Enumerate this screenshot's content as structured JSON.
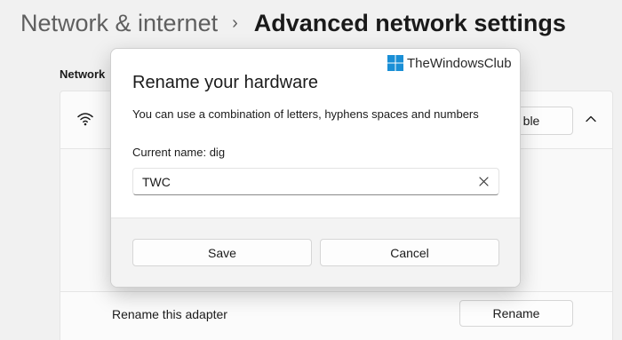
{
  "breadcrumb": {
    "parent": "Network & internet",
    "separator": "›",
    "current": "Advanced network settings"
  },
  "section": {
    "label": "Network"
  },
  "adapter_card": {
    "icon": "wifi-icon",
    "action_label": "ble",
    "expand_icon": "chevron-up-icon"
  },
  "rename_row": {
    "label": "Rename this adapter",
    "button_label": "Rename"
  },
  "dialog": {
    "title": "Rename your hardware",
    "description": "You can use a combination of letters, hyphens spaces and numbers",
    "current_name_label": "Current name: dig",
    "input_value": "TWC",
    "clear_icon": "close-icon",
    "save_label": "Save",
    "cancel_label": "Cancel"
  },
  "watermark": {
    "text": "TheWindowsClub",
    "logo_color": "#1a8fd6"
  },
  "colors": {
    "background": "#f1f1f1",
    "dialog_bg": "#ffffff",
    "dialog_footer_bg": "#f3f3f3",
    "text": "#1b1b1b",
    "muted_text": "#5f5f5f"
  }
}
